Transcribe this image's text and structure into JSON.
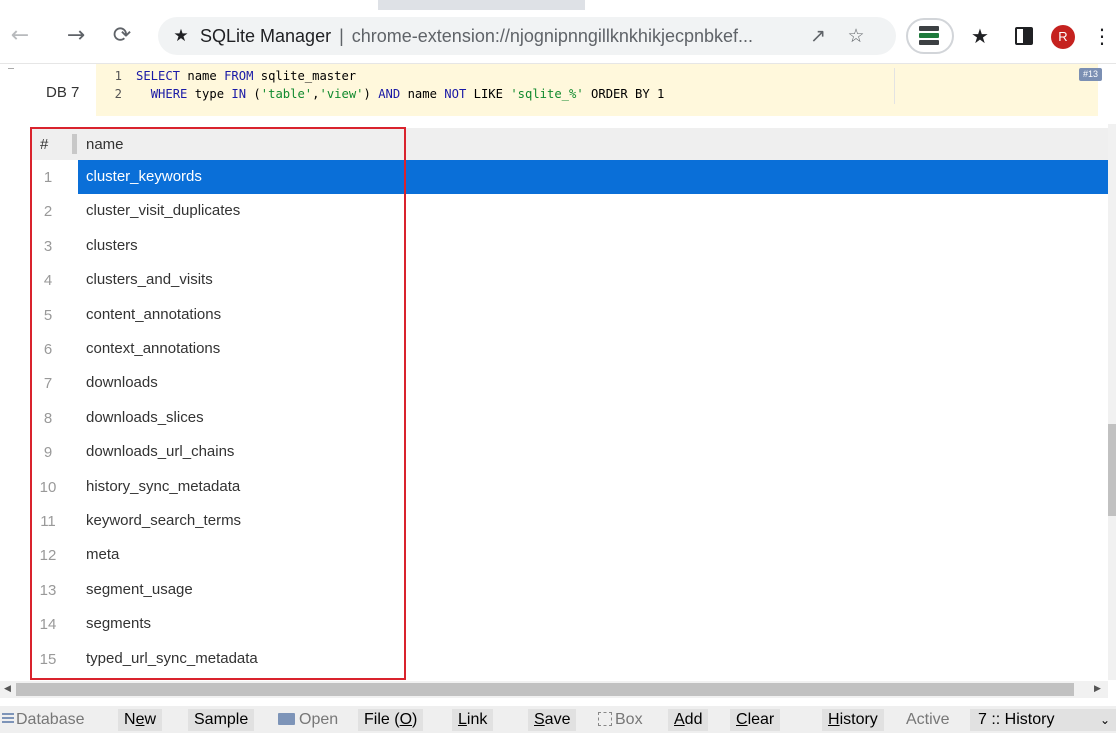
{
  "browser": {
    "omnibox": {
      "page_title": "SQLite Manager",
      "separator": "|",
      "url": "chrome-extension://njognipnngillknkhikjecpnbkef..."
    },
    "profile_initial": "R"
  },
  "editor": {
    "db_label": "DB 7",
    "lines": [
      {
        "num": "1",
        "kw1": "SELECT",
        "t1": " name ",
        "kw2": "FROM",
        "t2": " sqlite_master"
      },
      {
        "num": "2",
        "kw1": "WHERE",
        "t1": " type ",
        "kw2": "IN",
        "t2": " (",
        "s1": "'table'",
        "t3": ",",
        "s2": "'view'",
        "t4": ") ",
        "kw3": "AND",
        "t5": " name ",
        "kw4": "NOT",
        "t6": " LIKE ",
        "s3": "'sqlite_%'",
        "t7": " ORDER BY 1"
      }
    ],
    "badge": "#13"
  },
  "results": {
    "header": {
      "index": "#",
      "column": "name"
    },
    "rows": [
      {
        "n": "1",
        "name": "cluster_keywords"
      },
      {
        "n": "2",
        "name": "cluster_visit_duplicates"
      },
      {
        "n": "3",
        "name": "clusters"
      },
      {
        "n": "4",
        "name": "clusters_and_visits"
      },
      {
        "n": "5",
        "name": "content_annotations"
      },
      {
        "n": "6",
        "name": "context_annotations"
      },
      {
        "n": "7",
        "name": "downloads"
      },
      {
        "n": "8",
        "name": "downloads_slices"
      },
      {
        "n": "9",
        "name": "downloads_url_chains"
      },
      {
        "n": "10",
        "name": "history_sync_metadata"
      },
      {
        "n": "11",
        "name": "keyword_search_terms"
      },
      {
        "n": "12",
        "name": "meta"
      },
      {
        "n": "13",
        "name": "segment_usage"
      },
      {
        "n": "14",
        "name": "segments"
      },
      {
        "n": "15",
        "name": "typed_url_sync_metadata"
      }
    ],
    "selected_row": 1
  },
  "bottom_bar": {
    "database": "Database",
    "new_pre": "N",
    "new_u": "e",
    "new_post": "w",
    "sample": "Sample",
    "open": "Open",
    "file": "File (",
    "file_u": "O",
    "file_post": ")",
    "link_u": "L",
    "link_post": "ink",
    "save_u": "S",
    "save_post": "ave",
    "box": "Box",
    "add_u": "A",
    "add_post": "dd",
    "clear_u": "C",
    "clear_post": "lear",
    "history_u": "H",
    "history_post": "istory",
    "active": "Active",
    "selected_db": "7 :: History"
  },
  "colors": {
    "selection": "#0a6fd8",
    "highlight_border": "#d9232d",
    "editor_background": "#fff8dc",
    "avatar": "#c5221f"
  },
  "icons": [
    "back-arrow-icon",
    "forward-arrow-icon",
    "reload-icon",
    "puzzle-extension-icon",
    "share-icon",
    "star-bookmark-icon",
    "sqlite-extension-icon",
    "extensions-puzzle-icon",
    "side-panel-icon",
    "more-vertical-icon",
    "database-menu-icon",
    "folder-icon",
    "box-icon",
    "dropdown-caret-icon"
  ]
}
